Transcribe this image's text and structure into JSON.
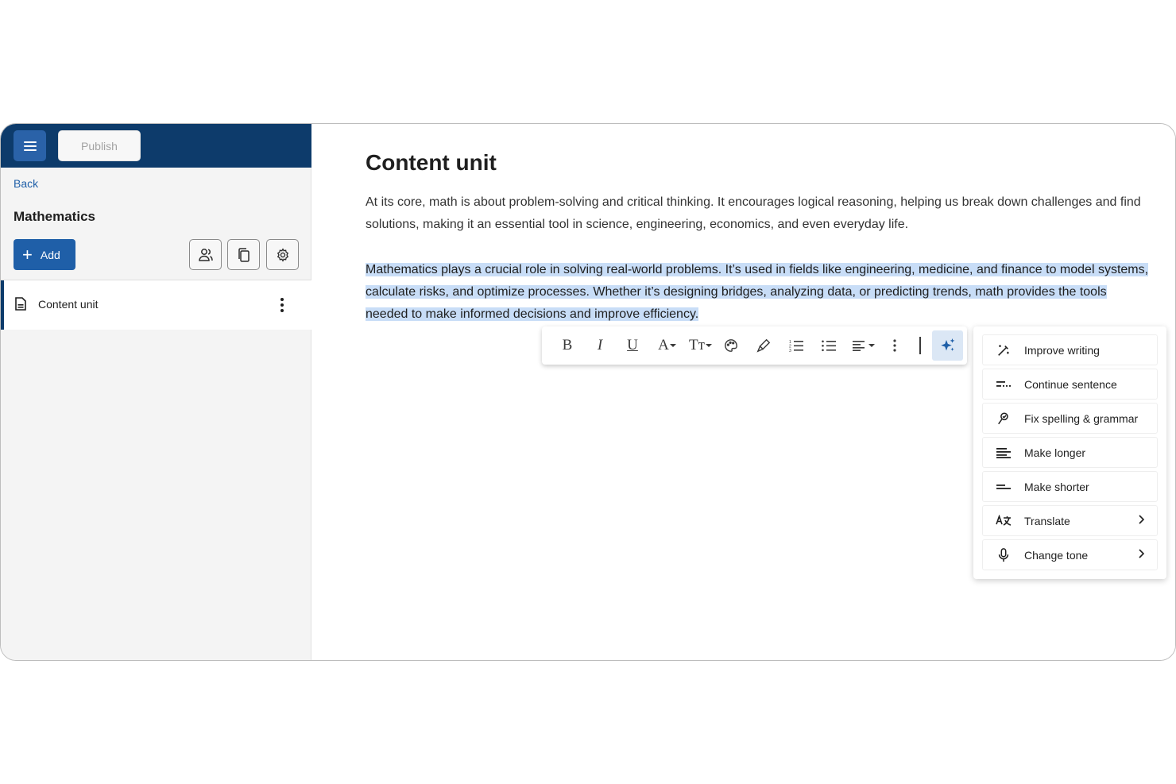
{
  "header": {
    "publish_label": "Publish"
  },
  "sidebar": {
    "back_label": "Back",
    "course_title": "Mathematics",
    "add_label": "Add",
    "items": [
      {
        "label": "Content unit"
      }
    ]
  },
  "main": {
    "title": "Content unit",
    "paragraph1": "At its core, math is about problem-solving and critical thinking. It encourages logical reasoning, helping us break down challenges and find solutions, making it an essential tool in science, engineering, economics, and even everyday life.",
    "paragraph2": "Mathematics plays a crucial role in solving real-world problems. It’s used in fields like engineering, medicine, and finance to model systems, calculate risks, and optimize processes. Whether it’s designing bridges, analyzing data, or predicting trends, math provides the tools needed to make informed decisions and improve efficiency."
  },
  "toolbar": {
    "bold": "B",
    "italic": "I",
    "underline": "U",
    "font_color": "A",
    "font_size": "Tт",
    "icons": [
      "bold-icon",
      "italic-icon",
      "underline-icon",
      "font-color-icon",
      "font-size-icon",
      "palette-icon",
      "highlighter-icon",
      "numbered-list-icon",
      "bullet-list-icon",
      "align-icon",
      "more-icon",
      "ai-sparkle-icon"
    ]
  },
  "ai_menu": {
    "items": [
      {
        "label": "Improve writing",
        "icon": "magic-wand-icon"
      },
      {
        "label": "Continue sentence",
        "icon": "continue-icon"
      },
      {
        "label": "Fix spelling & grammar",
        "icon": "spellcheck-icon"
      },
      {
        "label": "Make longer",
        "icon": "lines-long-icon"
      },
      {
        "label": "Make shorter",
        "icon": "lines-short-icon"
      },
      {
        "label": "Translate",
        "icon": "translate-icon"
      },
      {
        "label": "Change tone",
        "icon": "microphone-icon"
      }
    ]
  },
  "colors": {
    "topbar": "#0d3b6b",
    "accent": "#1f5fa8",
    "selection": "#c8ddf7"
  }
}
